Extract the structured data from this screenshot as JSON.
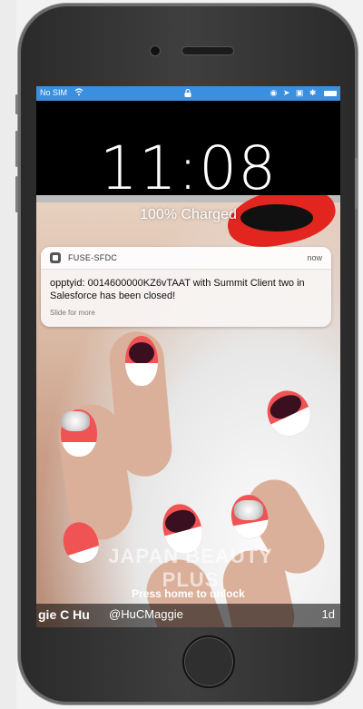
{
  "status_bar": {
    "carrier": "No SIM",
    "wifi_icon": "wifi-icon",
    "lock_icon": "lock-icon",
    "right_icons": "◉ ➤ ▣ ✱"
  },
  "lock_screen": {
    "time": "11:08",
    "charge_status": "100% Charged",
    "unlock_hint": "Press home to unlock"
  },
  "notification": {
    "app_name": "FUSE-SFDC",
    "time": "now",
    "message": "opptyid: 0014600000KZ6vTAAT with Summit Client two in Salesforce has been closed!",
    "hint": "Slide for more"
  },
  "wallpaper": {
    "watermark": "JAPAN BEAUTY PLUS",
    "caption_name": "gie C Hu",
    "caption_handle": "@HuCMaggie",
    "caption_age": "1d"
  },
  "colors": {
    "status_bar": "#3b8fe0",
    "accent_red": "#e2251e"
  }
}
